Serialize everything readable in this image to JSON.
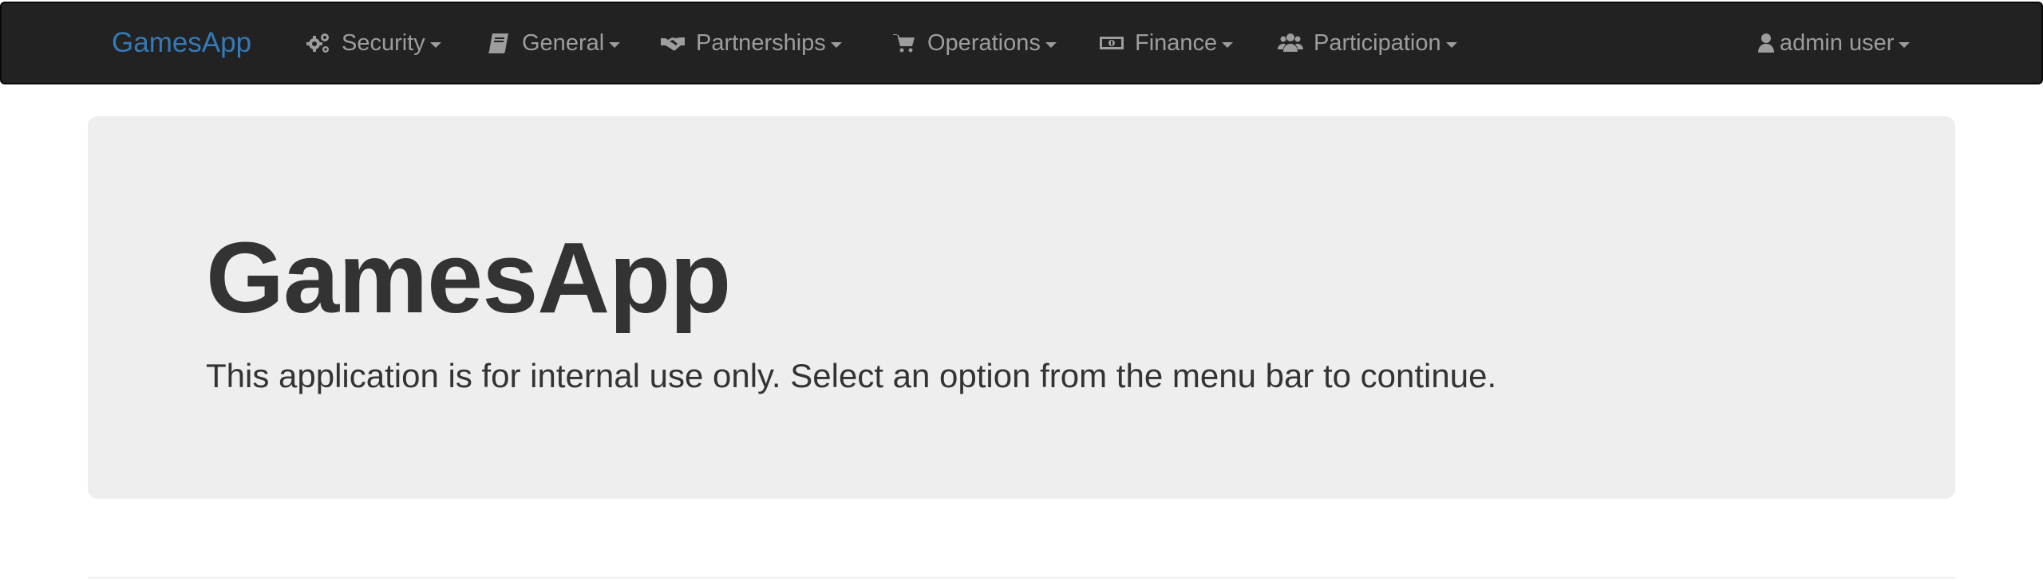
{
  "navbar": {
    "brand": "GamesApp",
    "items": [
      {
        "label": "Security",
        "icon": "cogs-icon"
      },
      {
        "label": "General",
        "icon": "book-icon"
      },
      {
        "label": "Partnerships",
        "icon": "handshake-icon"
      },
      {
        "label": "Operations",
        "icon": "shopping-cart-icon"
      },
      {
        "label": "Finance",
        "icon": "money-icon"
      },
      {
        "label": "Participation",
        "icon": "users-icon"
      }
    ],
    "user": {
      "label": "admin user",
      "icon": "user-icon"
    }
  },
  "jumbotron": {
    "title": "GamesApp",
    "text": "This application is for internal use only. Select an option from the menu bar to continue."
  },
  "colors": {
    "navbar_bg": "#222222",
    "brand": "#337ab7",
    "nav_text": "#9d9d9d",
    "jumbotron_bg": "#eeeeee",
    "body_text": "#333333"
  }
}
